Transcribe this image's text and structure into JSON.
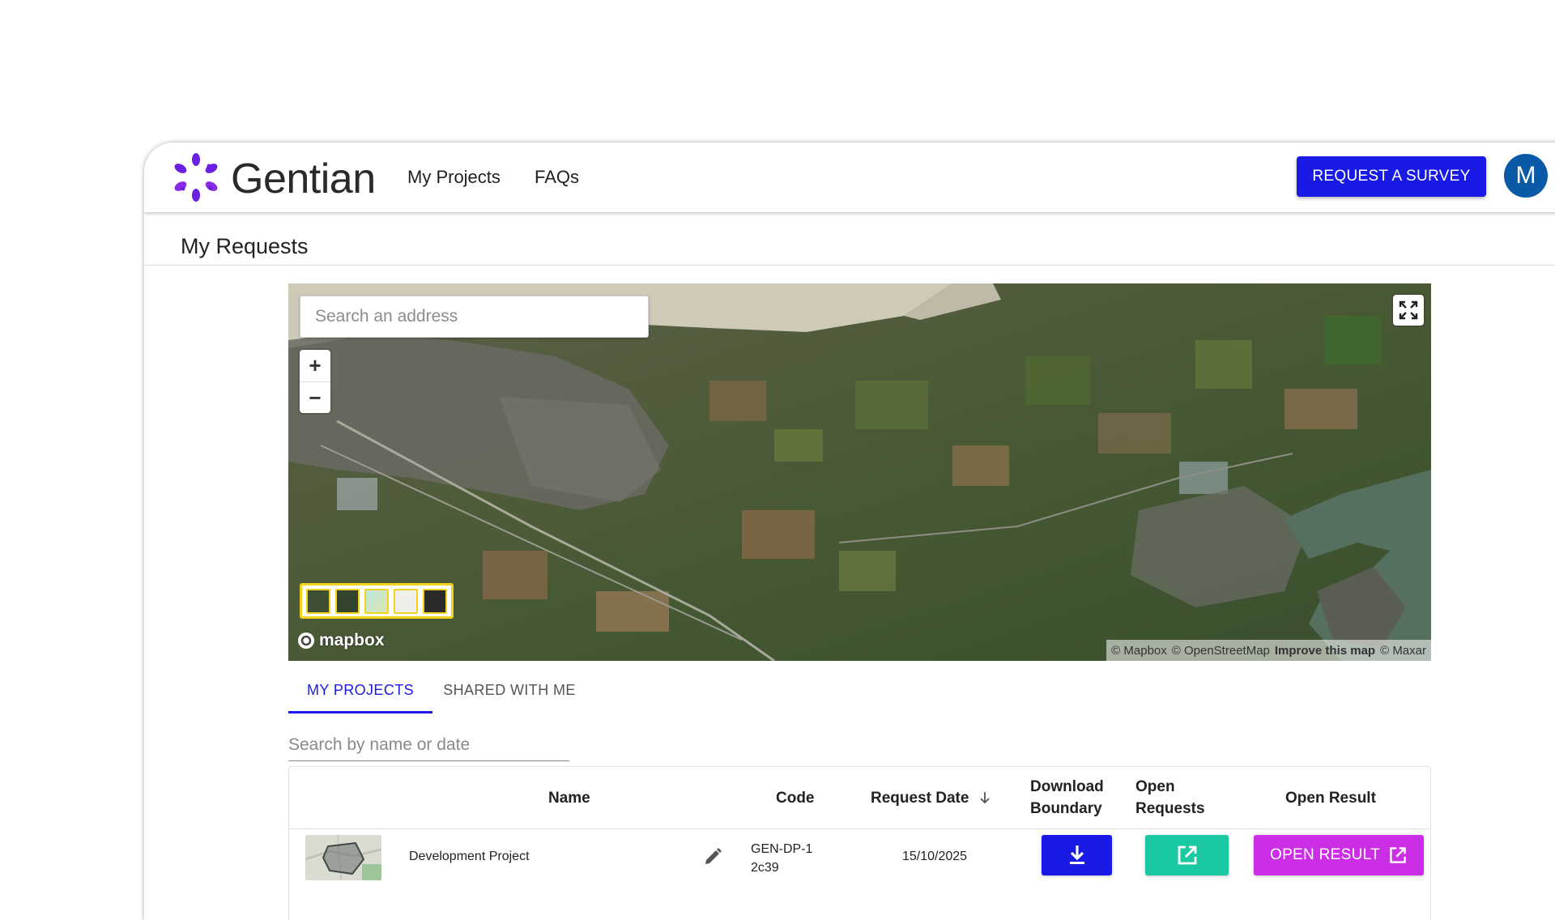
{
  "brand": {
    "name": "Gentian",
    "colors": {
      "primary": "#1a1ae6",
      "logo": "#6b1fe0",
      "avatar": "#0b5aa8",
      "success": "#1ac9a2",
      "result": "#cc2ee6"
    }
  },
  "nav": {
    "items": [
      {
        "label": "My Projects"
      },
      {
        "label": "FAQs"
      }
    ],
    "cta_label": "REQUEST A SURVEY",
    "avatar_initial": "M"
  },
  "page": {
    "title": "My Requests"
  },
  "map": {
    "search_placeholder": "Search an address",
    "zoom_in": "+",
    "zoom_out": "−",
    "provider": "mapbox",
    "style_options": [
      "satellite-streets",
      "satellite",
      "outdoors",
      "light",
      "dark"
    ],
    "attribution": {
      "mapbox": "© Mapbox",
      "osm": "© OpenStreetMap",
      "improve": "Improve this map",
      "maxar": "© Maxar"
    },
    "icons": {
      "fullscreen": "fullscreen-icon",
      "logo": "mapbox-logo-icon"
    }
  },
  "tabs": [
    {
      "label": "MY PROJECTS",
      "active": true
    },
    {
      "label": "SHARED WITH ME",
      "active": false
    }
  ],
  "table": {
    "search_placeholder": "Search by name or date",
    "columns": {
      "name": "Name",
      "code": "Code",
      "request_date": "Request Date",
      "download_boundary": "Download Boundary",
      "open_requests": "Open Requests",
      "open_result": "Open Result"
    },
    "sort": {
      "column": "request_date",
      "direction": "descending"
    },
    "rows": [
      {
        "name": "Development Project",
        "code": "GEN-DP-12c39",
        "request_date": "15/10/2025",
        "open_result_label": "OPEN RESULT"
      }
    ]
  }
}
